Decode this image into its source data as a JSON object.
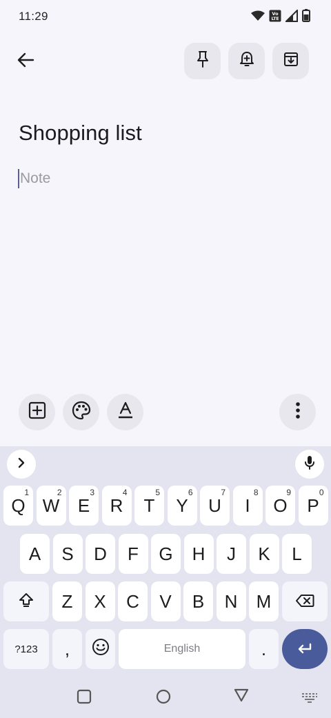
{
  "status_bar": {
    "time": "11:29",
    "volte_label": "Vo LTE",
    "icons": [
      "wifi-icon",
      "volte-icon",
      "cell-signal-icon",
      "battery-icon"
    ]
  },
  "top_bar": {
    "icons": [
      "back-arrow-icon",
      "pin-icon",
      "reminder-bell-icon",
      "archive-icon"
    ]
  },
  "note": {
    "title": "Shopping list",
    "body_placeholder": "Note"
  },
  "editor_toolbar": {
    "icons": [
      "add-box-icon",
      "palette-icon",
      "text-format-icon",
      "more-vert-icon"
    ]
  },
  "keyboard": {
    "row1": [
      {
        "label": "Q",
        "hint": "1"
      },
      {
        "label": "W",
        "hint": "2"
      },
      {
        "label": "E",
        "hint": "3"
      },
      {
        "label": "R",
        "hint": "4"
      },
      {
        "label": "T",
        "hint": "5"
      },
      {
        "label": "Y",
        "hint": "6"
      },
      {
        "label": "U",
        "hint": "7"
      },
      {
        "label": "I",
        "hint": "8"
      },
      {
        "label": "O",
        "hint": "9"
      },
      {
        "label": "P",
        "hint": "0"
      }
    ],
    "row2": [
      "A",
      "S",
      "D",
      "F",
      "G",
      "H",
      "J",
      "K",
      "L"
    ],
    "row3": [
      "Z",
      "X",
      "C",
      "V",
      "B",
      "N",
      "M"
    ],
    "symbols_label": "?123",
    "comma_label": ",",
    "space_label": "English",
    "period_label": ".",
    "icons": [
      "expand-arrow-icon",
      "microphone-icon",
      "shift-icon",
      "backspace-icon",
      "emoji-icon",
      "enter-icon"
    ]
  },
  "nav_bar": {
    "icons": [
      "recents-square-icon",
      "home-circle-icon",
      "back-triangle-icon",
      "keyboard-switch-icon"
    ]
  },
  "colors": {
    "background": "#f5f5fb",
    "keyboard_background": "#e3e4ef",
    "button_background": "#e8e7ee",
    "enter_key": "#4a5b9c",
    "placeholder_text": "#9a9aa2"
  }
}
